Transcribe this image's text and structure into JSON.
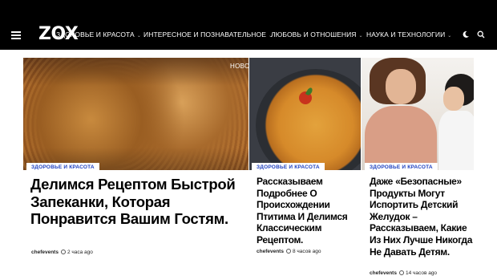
{
  "header": {
    "logo": "ZOX",
    "nav_items": [
      {
        "label": "ЗДОРОВЬЕ И КРАСОТА"
      },
      {
        "label": "ИНТЕРЕСНОЕ И ПОЗНАВАТЕЛЬНОЕ"
      },
      {
        "label": "ЛЮБОВЬ И ОТНОШЕНИЯ"
      },
      {
        "label": "НАУКА И ТЕХНОЛОГИИ"
      }
    ],
    "icons": [
      "menu-icon",
      "moon-icon",
      "search-icon",
      "chevron-down-icon"
    ]
  },
  "overlay_label": "НОВОСТИ",
  "articles": [
    {
      "category": "ЗДОРОВЬЕ И КРАСОТА",
      "title": "Делимся Рецептом Быстрой Запеканки, Которая Понравится Вашим Гостям.",
      "author": "chefevents",
      "time": "2 часа ago"
    },
    {
      "category": "ЗДОРОВЬЕ И КРАСОТА",
      "title": "Рассказываем Подробнее О Происхождении Птитима И Делимся Классическим Рецептом.",
      "author": "chefevents",
      "time": "8 часов ago"
    },
    {
      "category": "ЗДОРОВЬЕ И КРАСОТА",
      "title": "Даже «Безопасные» Продукты Могут Испортить Детский Желудок – Рассказываем, Какие Из Них Лучше Никогда Не Давать Детям.",
      "author": "chefevents",
      "time": "14 часов ago"
    }
  ],
  "colors": {
    "nav_bg": "#000000",
    "category_text": "#1d3fbf",
    "title_text": "#000000"
  }
}
